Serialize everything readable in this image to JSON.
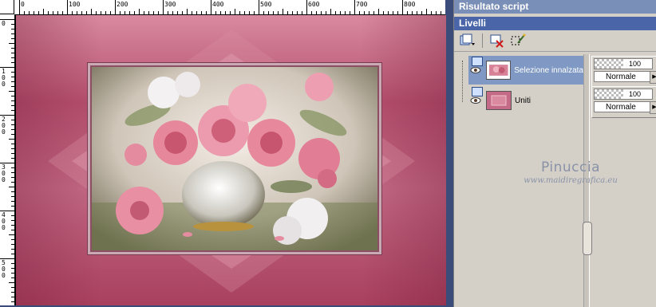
{
  "panels": {
    "script_title": "Risultato script",
    "layers_title": "Livelli"
  },
  "ruler": {
    "top_labels": [
      "0",
      "100",
      "200",
      "300",
      "400",
      "500",
      "600",
      "700",
      "800"
    ],
    "left_labels": [
      "0",
      "100",
      "200",
      "300",
      "400",
      "500"
    ]
  },
  "layers": [
    {
      "name": "Selezione innalzata",
      "opacity": "100",
      "blend_mode": "Normale",
      "selected": true
    },
    {
      "name": "Uniti",
      "opacity": "100",
      "blend_mode": "Normale",
      "selected": false
    }
  ],
  "watermark": {
    "name": "Pinuccia",
    "site": "www.maidiregrafica.eu"
  },
  "icons": {
    "new_layer": "new-layer-icon",
    "delete_layer": "delete-layer-icon",
    "edit_selection": "edit-selection-icon",
    "visibility": "eye-icon"
  },
  "colors": {
    "panel_title_active": "#4a66a8",
    "panel_title_inactive": "#7a8fb8",
    "selected_layer": "#7f99c4",
    "canvas_pink": "#c46a86"
  }
}
